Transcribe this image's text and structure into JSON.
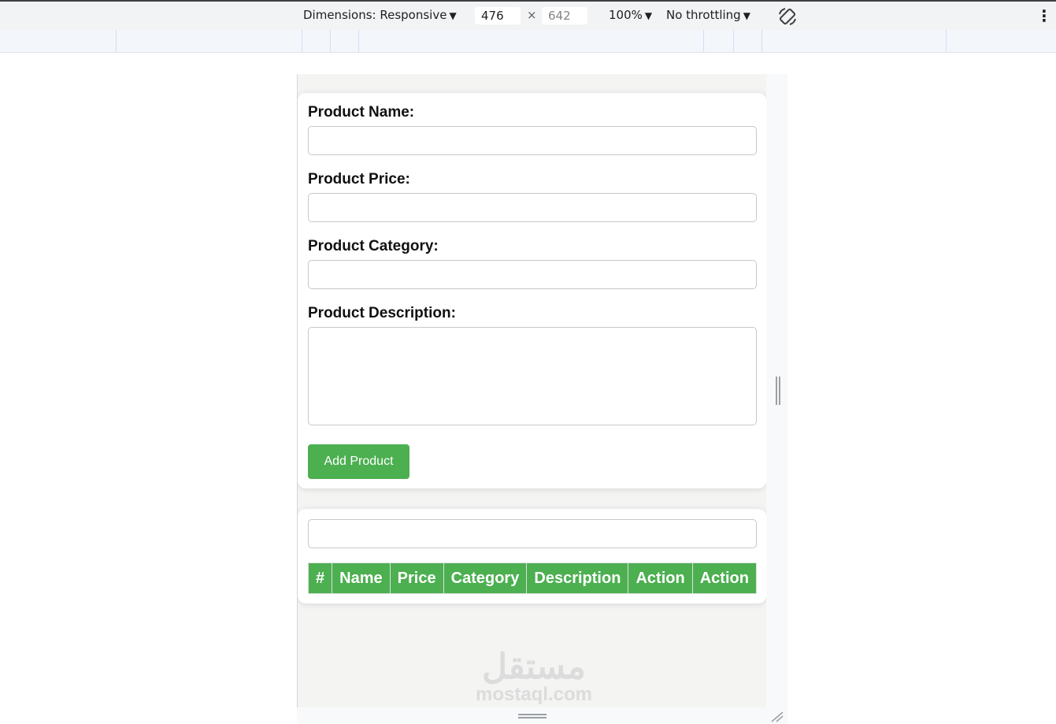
{
  "devtools": {
    "dimensions_label": "Dimensions: Responsive",
    "width_value": "476",
    "times_sign": "×",
    "height_value": "642",
    "zoom_label": "100%",
    "throttle_label": "No throttling",
    "caret": "▼",
    "more_icon": "⋮"
  },
  "form": {
    "name_label": "Product Name:",
    "price_label": "Product Price:",
    "category_label": "Product Category:",
    "description_label": "Product Description:",
    "name_value": "",
    "price_value": "",
    "category_value": "",
    "description_value": "",
    "add_button": "Add Product"
  },
  "table": {
    "search_value": "",
    "headers": [
      "#",
      "Name",
      "Price",
      "Category",
      "Description",
      "Action",
      "Action"
    ]
  },
  "watermark": {
    "arabic": "مستقل",
    "latin": "mostaql.com"
  },
  "colors": {
    "accent": "#4caf50",
    "toolbar_bg": "#f1f3f4",
    "viewport_bg": "#f4f4f3"
  }
}
